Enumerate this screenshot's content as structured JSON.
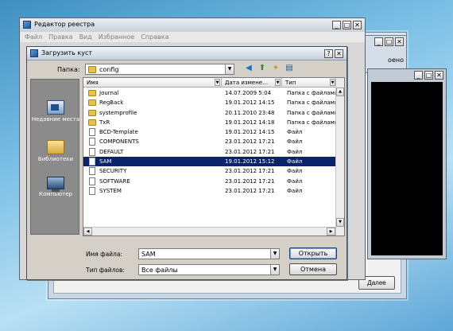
{
  "regedit": {
    "title": "Редактор реестра",
    "menu": [
      "Файл",
      "Правка",
      "Вид",
      "Избранное",
      "Справка"
    ]
  },
  "background": {
    "partial_text": "оено",
    "next_button": "Далее"
  },
  "dialog": {
    "title": "Загрузить куст",
    "lookin_label": "Папка:",
    "lookin_value": "config",
    "places": [
      {
        "label": "Недавние места",
        "icon": "recent-places-icon"
      },
      {
        "label": "Библиотеки",
        "icon": "libraries-icon"
      },
      {
        "label": "Компьютер",
        "icon": "computer-icon"
      }
    ],
    "columns": [
      "Имя",
      "Дата измене…",
      "Тип"
    ],
    "files": [
      {
        "name": "Journal",
        "date": "14.07.2009 5:04",
        "type": "Папка с файлами",
        "kind": "folder"
      },
      {
        "name": "RegBack",
        "date": "19.01.2012 14:15",
        "type": "Папка с файлами",
        "kind": "folder"
      },
      {
        "name": "systemprofile",
        "date": "20.11.2010 23:48",
        "type": "Папка с файлами",
        "kind": "folder"
      },
      {
        "name": "TxR",
        "date": "19.01.2012 14:18",
        "type": "Папка с файлами",
        "kind": "folder"
      },
      {
        "name": "BCD-Template",
        "date": "19.01.2012 14:15",
        "type": "Файл",
        "kind": "file"
      },
      {
        "name": "COMPONENTS",
        "date": "23.01.2012 17:21",
        "type": "Файл",
        "kind": "file"
      },
      {
        "name": "DEFAULT",
        "date": "23.01.2012 17:21",
        "type": "Файл",
        "kind": "file"
      },
      {
        "name": "SAM",
        "date": "19.01.2012 15:12",
        "type": "Файл",
        "kind": "file",
        "selected": true
      },
      {
        "name": "SECURITY",
        "date": "23.01.2012 17:21",
        "type": "Файл",
        "kind": "file"
      },
      {
        "name": "SOFTWARE",
        "date": "23.01.2012 17:21",
        "type": "Файл",
        "kind": "file"
      },
      {
        "name": "SYSTEM",
        "date": "23.01.2012 17:21",
        "type": "Файл",
        "kind": "file"
      }
    ],
    "filename_label": "Имя файла:",
    "filename_value": "SAM",
    "filetype_label": "Тип файлов:",
    "filetype_value": "Все файлы",
    "open_button": "Открыть",
    "cancel_button": "Отмена"
  },
  "colors": {
    "selection": "#0a246a",
    "dialog_bg": "#d4d0c8",
    "desktop": "#7cc0e6"
  }
}
